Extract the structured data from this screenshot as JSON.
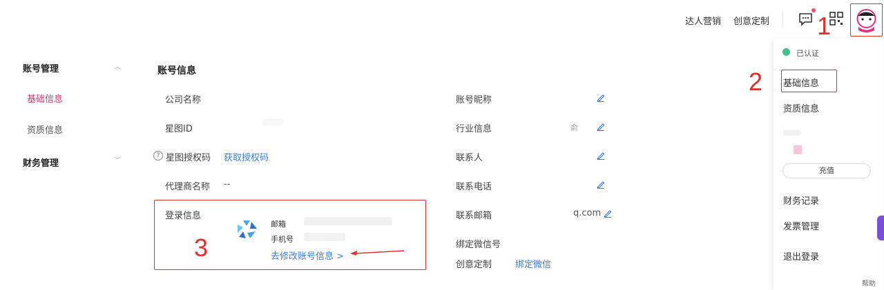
{
  "header": {
    "nav": [
      "达人营销",
      "创意定制"
    ],
    "annotation_1": "1"
  },
  "sidebar": {
    "groups": [
      {
        "title": "账号管理",
        "items": [
          "基础信息",
          "资质信息"
        ]
      },
      {
        "title": "财务管理",
        "items": []
      }
    ]
  },
  "main": {
    "section_title": "账号信息",
    "left_fields": [
      {
        "label": "公司名称",
        "value": ""
      },
      {
        "label": "星图ID",
        "value": ""
      },
      {
        "label": "星图授权码",
        "value": "获取授权码"
      },
      {
        "label": "代理商名称",
        "value": "--"
      }
    ],
    "login": {
      "label": "登录信息",
      "email_label": "邮箱",
      "phone_label": "手机号",
      "edit_link": "去修改账号信息 >"
    },
    "right_fields": [
      {
        "label": "账号昵称",
        "value": ""
      },
      {
        "label": "行业信息",
        "value": "俞"
      },
      {
        "label": "联系人",
        "value": ""
      },
      {
        "label": "联系电话",
        "value": ""
      },
      {
        "label": "联系邮箱",
        "value": "q.com"
      },
      {
        "label": "绑定微信号",
        "value": ""
      },
      {
        "label": "创意定制",
        "value": "绑定微信"
      }
    ],
    "annotation_3": "3"
  },
  "dropdown": {
    "verified": "已认证",
    "items": [
      "基础信息",
      "资质信息"
    ],
    "charge": "充值",
    "bottom_items": [
      "财务记录",
      "发票管理",
      "退出登录"
    ],
    "annotation_2": "2"
  },
  "help": "帮助"
}
